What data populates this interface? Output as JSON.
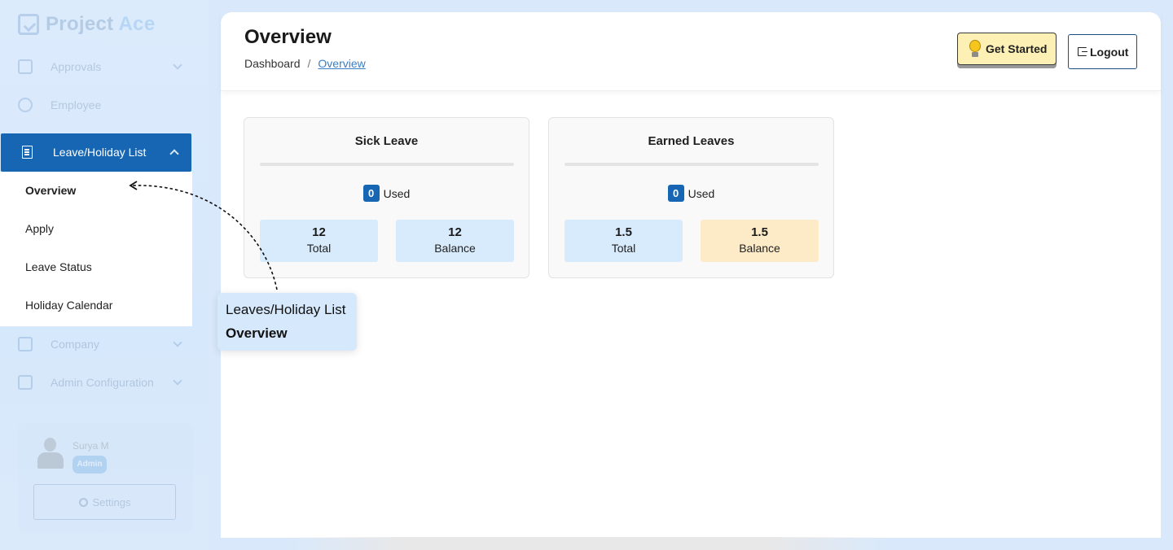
{
  "app": {
    "logo": {
      "part1": "Project",
      "part2": "Ace"
    }
  },
  "sidebar": {
    "items": [
      {
        "label": "Approvals"
      },
      {
        "label": "Employee"
      },
      {
        "label": "Leave/Holiday List"
      },
      {
        "label": "Company"
      },
      {
        "label": "Admin Configuration"
      }
    ],
    "submenu": [
      "Overview",
      "Apply",
      "Leave Status",
      "Holiday Calendar"
    ],
    "profile": {
      "name": "Surya M",
      "role": "Admin",
      "settings_label": "Settings"
    }
  },
  "header": {
    "title": "Overview",
    "breadcrumb": {
      "root": "Dashboard",
      "separator": "/",
      "current": "Overview"
    },
    "get_started_label": "Get Started",
    "logout_label": "Logout"
  },
  "cards": [
    {
      "title": "Sick Leave",
      "used": "0",
      "used_label": "Used",
      "total": "12",
      "total_label": "Total",
      "balance": "12",
      "balance_label": "Balance"
    },
    {
      "title": "Earned Leaves",
      "used": "0",
      "used_label": "Used",
      "total": "1.5",
      "total_label": "Total",
      "balance": "1.5",
      "balance_label": "Balance"
    }
  ],
  "tooltip": {
    "line1": "Leaves/Holiday List",
    "line2": "Overview"
  },
  "colors": {
    "accent": "#1766b3",
    "sidebar_bg": "#dcebfc",
    "stat_blue": "#d8ebfd",
    "stat_amber": "#fdebc8",
    "get_started_bg": "#fdf0b4"
  }
}
